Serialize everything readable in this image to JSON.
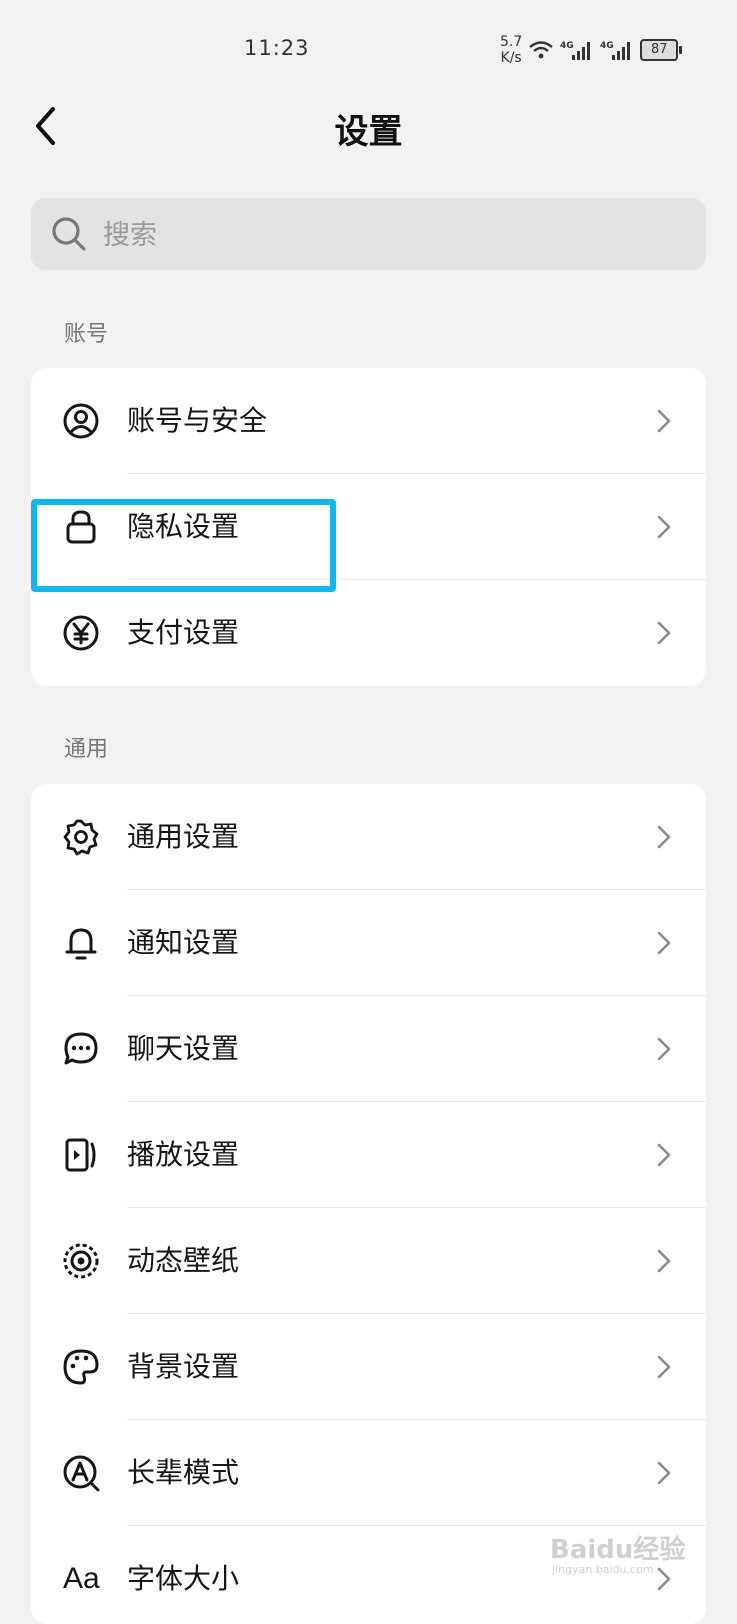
{
  "status_bar": {
    "time": "11:23",
    "net_speed_value": "5.7",
    "net_speed_unit": "K/s",
    "signal_1": "4G",
    "signal_2": "4G",
    "battery": "87"
  },
  "header": {
    "title": "设置"
  },
  "search": {
    "placeholder": "搜索"
  },
  "sections": {
    "account": {
      "label": "账号",
      "items": [
        {
          "label": "账号与安全",
          "icon": "user-circle-icon"
        },
        {
          "label": "隐私设置",
          "icon": "lock-icon"
        },
        {
          "label": "支付设置",
          "icon": "yen-icon"
        }
      ]
    },
    "general": {
      "label": "通用",
      "items": [
        {
          "label": "通用设置",
          "icon": "gear-icon"
        },
        {
          "label": "通知设置",
          "icon": "bell-icon"
        },
        {
          "label": "聊天设置",
          "icon": "chat-bubble-icon"
        },
        {
          "label": "播放设置",
          "icon": "play-screen-icon"
        },
        {
          "label": "动态壁纸",
          "icon": "target-icon"
        },
        {
          "label": "背景设置",
          "icon": "palette-icon"
        },
        {
          "label": "长辈模式",
          "icon": "elder-mode-icon"
        },
        {
          "label": "字体大小",
          "icon": "font-size-icon",
          "icon_text": "Aa"
        }
      ]
    }
  },
  "highlight_color": "#10b7e8",
  "watermark": {
    "text": "Baidu经验",
    "subtext": "jingyan.baidu.com"
  }
}
